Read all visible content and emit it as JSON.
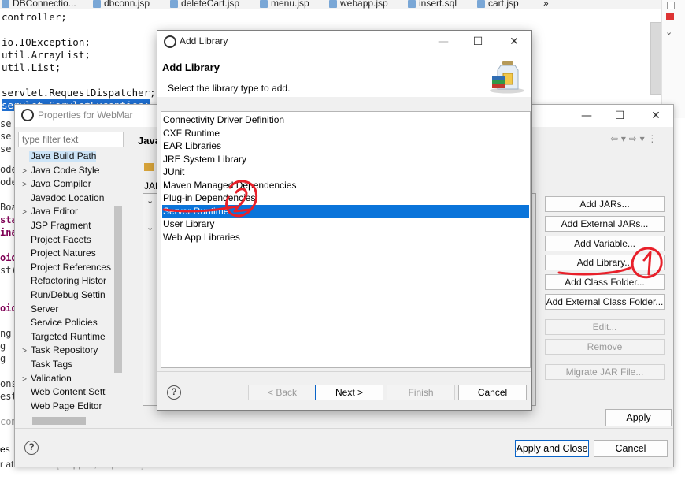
{
  "editor": {
    "tabs": [
      "DBConnectio...",
      "dbconn.jsp",
      "deleteCart.jsp",
      "menu.jsp",
      "webapp.jsp",
      "insert.sql",
      "cart.jsp",
      "»"
    ],
    "code_lines": [
      "controller;",
      "",
      "io.IOException;",
      "util.ArrayList;",
      "util.List;",
      "",
      "servlet.RequestDispatcher;"
    ],
    "highlighted_line": "servlet.ServletException;",
    "left_fragments": [
      "se",
      "se",
      "se",
      "",
      "ode",
      "ode",
      "",
      "Boa",
      "stat",
      "inal",
      "",
      "oid",
      "st(",
      "",
      "",
      "oid",
      "",
      "",
      "ng",
      "g",
      "g",
      "",
      "onse",
      "est",
      "",
      "com"
    ],
    "bottom_status": "r at localhost",
    "bottom_status_gray": "[Stopped, Republish]",
    "bottom_left_partial": "es"
  },
  "properties": {
    "title": "Properties for WebMar",
    "filter_placeholder": "type filter text",
    "tree_items": [
      {
        "label": "Java Build Path",
        "arrow": "",
        "selected": true
      },
      {
        "label": "Java Code Style",
        "arrow": ">"
      },
      {
        "label": "Java Compiler",
        "arrow": ">"
      },
      {
        "label": "Javadoc Location",
        "arrow": ""
      },
      {
        "label": "Java Editor",
        "arrow": ">"
      },
      {
        "label": "JSP Fragment",
        "arrow": ""
      },
      {
        "label": "Project Facets",
        "arrow": ""
      },
      {
        "label": "Project Natures",
        "arrow": ""
      },
      {
        "label": "Project References",
        "arrow": ""
      },
      {
        "label": "Refactoring Histor",
        "arrow": ""
      },
      {
        "label": "Run/Debug Settin",
        "arrow": ""
      },
      {
        "label": "Server",
        "arrow": ""
      },
      {
        "label": "Service Policies",
        "arrow": ""
      },
      {
        "label": "Targeted Runtime",
        "arrow": ""
      },
      {
        "label": "Task Repository",
        "arrow": ">"
      },
      {
        "label": "Task Tags",
        "arrow": ""
      },
      {
        "label": "Validation",
        "arrow": ">"
      },
      {
        "label": "Web Content Sett",
        "arrow": ""
      },
      {
        "label": "Web Page Editor",
        "arrow": ""
      }
    ],
    "page_title": "Java",
    "jar_label": "JAR",
    "buttons": [
      {
        "label": "Add JARs...",
        "enabled": true
      },
      {
        "label": "Add External JARs...",
        "enabled": true
      },
      {
        "label": "Add Variable...",
        "enabled": true
      },
      {
        "label": "Add Library...",
        "enabled": true
      },
      {
        "label": "Add Class Folder...",
        "enabled": true
      },
      {
        "label": "Add External Class Folder...",
        "enabled": true
      },
      {
        "label": "Edit...",
        "enabled": false
      },
      {
        "label": "Remove",
        "enabled": false
      },
      {
        "label": "Migrate JAR File...",
        "enabled": false
      }
    ],
    "apply_label": "Apply",
    "apply_close_label": "Apply and Close",
    "cancel_label": "Cancel",
    "help_label": "?"
  },
  "dialog": {
    "title": "Add Library",
    "heading": "Add Library",
    "subtitle": "Select the library type to add.",
    "libraries": [
      "Connectivity Driver Definition",
      "CXF Runtime",
      "EAR Libraries",
      "JRE System Library",
      "JUnit",
      "Maven Managed Dependencies",
      "Plug-in Dependencies",
      "Server Runtime",
      "User Library",
      "Web App Libraries"
    ],
    "selected_library": "Server Runtime",
    "back_label": "< Back",
    "next_label": "Next >",
    "finish_label": "Finish",
    "cancel_label": "Cancel",
    "help_label": "?"
  },
  "annotations": {
    "marks": [
      "1",
      "2"
    ],
    "color": "#e8202a"
  },
  "colors": {
    "selection": "#0a74da",
    "tree_selection": "#cce4f7",
    "default_border": "#0a64c8"
  }
}
